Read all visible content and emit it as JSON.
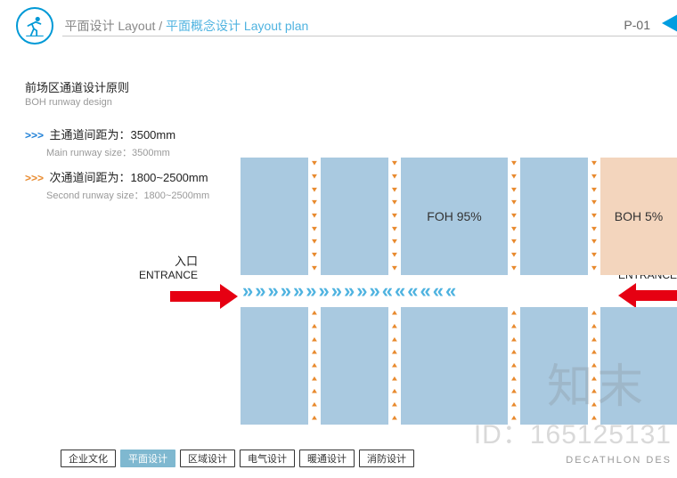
{
  "header": {
    "breadcrumb1": "平面设计 Layout / ",
    "breadcrumb2": "平面概念设计 Layout plan",
    "page_no": "P-01"
  },
  "titles": {
    "title_cn": "前场区通道设计原则",
    "title_en": "BOH runway design"
  },
  "specs": {
    "main_cn": "主通道间距为：3500mm",
    "main_en": "Main runway size：3500mm",
    "second_cn": "次通道间距为：1800~2500mm",
    "second_en": "Second runway size：1800~2500mm"
  },
  "diagram": {
    "foh_label": "FOH 95%",
    "boh_label": "BOH 5%",
    "entrance_cn": "入口",
    "entrance_en": "ENTRANCE"
  },
  "tabs": [
    "企业文化",
    "平面设计",
    "区域设计",
    "电气设计",
    "暖通设计",
    "消防设计"
  ],
  "active_tab_index": 1,
  "footer_brand": "DECATHLON DES",
  "watermark": {
    "line1": "知末",
    "line2": "ID：165125131"
  }
}
